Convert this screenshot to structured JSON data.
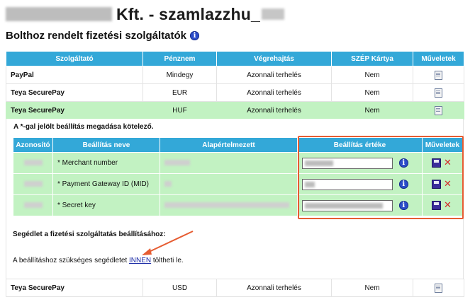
{
  "header": {
    "title": "Kft. - szamlazzhu_"
  },
  "section": {
    "title": "Bolthoz rendelt fizetési szolgáltatók"
  },
  "providers": {
    "columns": [
      "Szolgáltató",
      "Pénznem",
      "Végrehajtás",
      "SZÉP Kártya",
      "Műveletek"
    ],
    "rows": [
      {
        "name": "PayPal",
        "currency": "Mindegy",
        "execution": "Azonnali terhelés",
        "szep": "Nem"
      },
      {
        "name": "Teya SecurePay",
        "currency": "EUR",
        "execution": "Azonnali terhelés",
        "szep": "Nem"
      },
      {
        "name": "Teya SecurePay",
        "currency": "HUF",
        "execution": "Azonnali terhelés",
        "szep": "Nem"
      }
    ],
    "last_row": {
      "name": "Teya SecurePay",
      "currency": "USD",
      "execution": "Azonnali terhelés",
      "szep": "Nem"
    }
  },
  "settings": {
    "required_note": "A *-gal jelölt beállítás megadása kötelező.",
    "columns": [
      "Azonosító",
      "Beállítás neve",
      "Alapértelmezett",
      "Beállítás értéke",
      "Műveletek"
    ],
    "rows": [
      {
        "name": "* Merchant number"
      },
      {
        "name": "* Payment Gateway ID (MID)"
      },
      {
        "name": "* Secret key"
      }
    ]
  },
  "help": {
    "title": "Segédlet a fizetési szolgáltatás beállításához:",
    "text_before": "A beállításhoz szükséges segédletet ",
    "link": "INNEN",
    "text_after": " töltheti le."
  },
  "colors": {
    "header_blue": "#33a8d8",
    "row_green": "#c2f2c2",
    "highlight": "#e65c32",
    "link": "#1a2aa6"
  }
}
